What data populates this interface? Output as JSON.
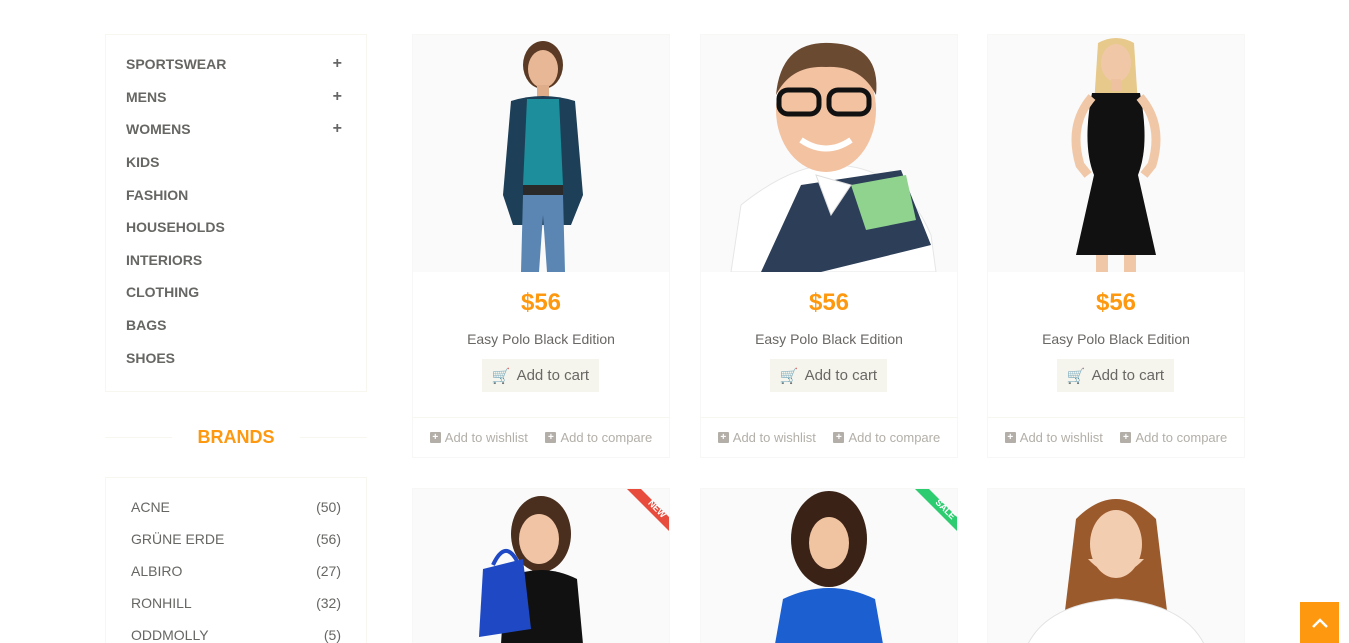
{
  "categories": [
    {
      "label": "SPORTSWEAR",
      "expandable": true
    },
    {
      "label": "MENS",
      "expandable": true
    },
    {
      "label": "WOMENS",
      "expandable": true
    },
    {
      "label": "KIDS",
      "expandable": false
    },
    {
      "label": "FASHION",
      "expandable": false
    },
    {
      "label": "HOUSEHOLDS",
      "expandable": false
    },
    {
      "label": "INTERIORS",
      "expandable": false
    },
    {
      "label": "CLOTHING",
      "expandable": false
    },
    {
      "label": "BAGS",
      "expandable": false
    },
    {
      "label": "SHOES",
      "expandable": false
    }
  ],
  "expand_glyph": "+",
  "brands": {
    "title": "BRANDS",
    "items": [
      {
        "name": "ACNE",
        "count": "(50)"
      },
      {
        "name": "GRÜNE ERDE",
        "count": "(56)"
      },
      {
        "name": "ALBIRO",
        "count": "(27)"
      },
      {
        "name": "RONHILL",
        "count": "(32)"
      },
      {
        "name": "ODDMOLLY",
        "count": "(5)"
      }
    ]
  },
  "products": [
    {
      "price": "$56",
      "name": "Easy Polo Black Edition",
      "cart_label": "Add to cart",
      "wishlist_label": "Add to wishlist",
      "compare_label": "Add to compare",
      "image": "woman-teal-cardigan"
    },
    {
      "price": "$56",
      "name": "Easy Polo Black Edition",
      "cart_label": "Add to cart",
      "wishlist_label": "Add to wishlist",
      "compare_label": "Add to compare",
      "image": "man-glasses-polo"
    },
    {
      "price": "$56",
      "name": "Easy Polo Black Edition",
      "cart_label": "Add to cart",
      "wishlist_label": "Add to wishlist",
      "compare_label": "Add to compare",
      "image": "woman-black-dress"
    },
    {
      "image": "woman-shopping-bag",
      "badge": "NEW"
    },
    {
      "image": "woman-blue-sweater",
      "badge": "SALE"
    },
    {
      "image": "girl-white-tshirt"
    }
  ],
  "colors": {
    "accent": "#fe980f",
    "new_badge": "#e74c3c",
    "sale_badge": "#2ecc71"
  }
}
